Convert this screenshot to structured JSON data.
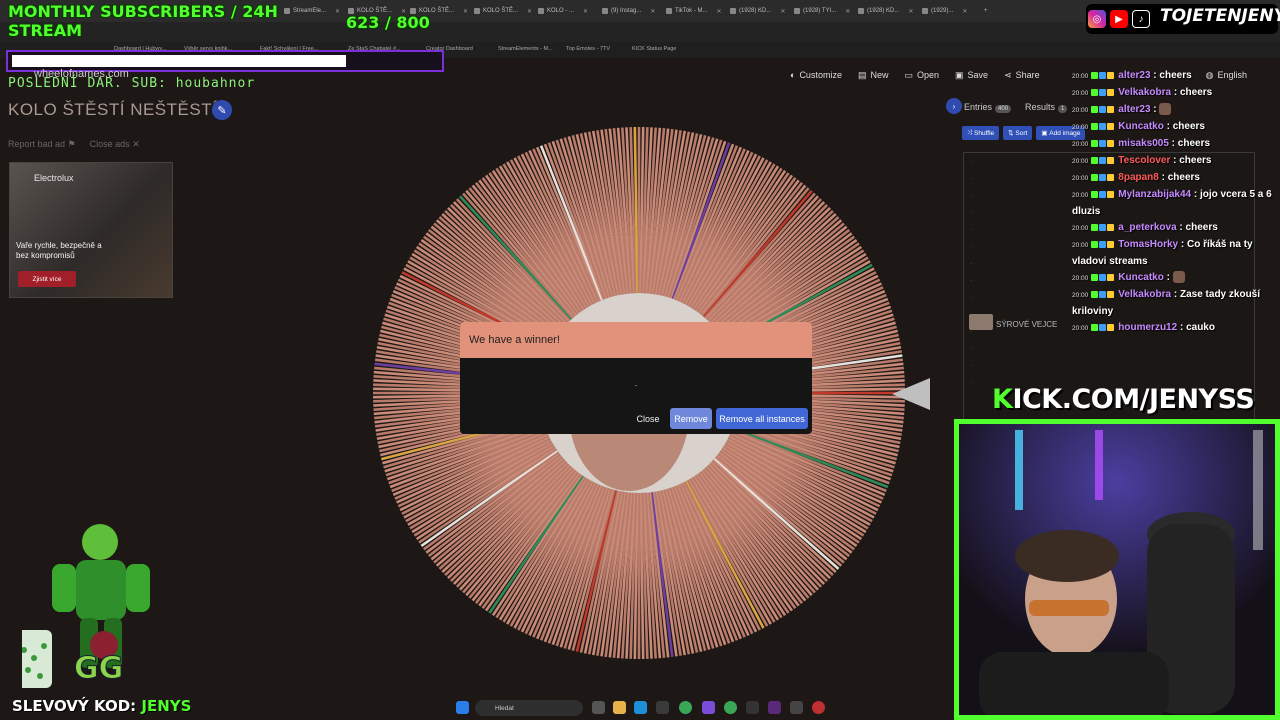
{
  "overlay": {
    "subs_title": "MONTHLY SUBSCRIBERS / 24H STREAM",
    "subs_count": "623 / 800",
    "last_donation": "POSLEDNÍ DAR. SUB: houbahnor",
    "social_handle": "TOJETENJENYS",
    "kick_url_k": "K",
    "kick_url_rest": "ICK.COM/JENYSS",
    "promo_label": "SLEVOVÝ KOD:",
    "promo_code": "JENYS",
    "accent_green": "#52ff2e"
  },
  "browser": {
    "tabs": [
      {
        "label": "StreamEle...",
        "icon": "streamelements-icon"
      },
      {
        "label": "KOLO ŠTĚ...",
        "icon": "wheel-icon"
      },
      {
        "label": "KOLO ŠTĚ...",
        "icon": "wheel-icon"
      },
      {
        "label": "KOLO ŠTĚ...",
        "icon": "wheel-icon"
      },
      {
        "label": "KOLO - ...",
        "icon": "wheel-icon"
      },
      {
        "label": "(9) Instag...",
        "icon": "instagram-icon"
      },
      {
        "label": "TikTok - M...",
        "icon": "tiktok-icon"
      },
      {
        "label": "(1928) KD...",
        "icon": "youtube-icon"
      },
      {
        "label": "(1928) TYI...",
        "icon": "youtube-icon"
      },
      {
        "label": "(1928) KD...",
        "icon": "youtube-icon"
      },
      {
        "label": "(1929)...",
        "icon": "youtube-icon"
      }
    ],
    "url": "wheelofnames.com",
    "bookmarks": [
      "Dashboard | Hubwy...",
      "Výběr servs knihk...",
      "Fakt! Schválení | Free...",
      "Ze StaS Chabatel #...",
      "Creator Dashboard",
      "StreamElements - M...",
      "Top Emotes - 7TV",
      "KICK Status Page"
    ]
  },
  "app": {
    "domain_text": "wheelofnames.com",
    "toolbar": [
      {
        "label": "Customize",
        "icon": "palette-icon"
      },
      {
        "label": "New",
        "icon": "file-icon"
      },
      {
        "label": "Open",
        "icon": "folder-icon"
      },
      {
        "label": "Save",
        "icon": "save-icon"
      },
      {
        "label": "Share",
        "icon": "share-icon"
      },
      {
        "label": "English",
        "icon": "globe-icon"
      }
    ],
    "wheel_title": "KOLO ŠTĚSTÍ NEŠTĚSTÍ",
    "report_ad": "Report bad ad",
    "close_ads": "Close ads",
    "ad": {
      "brand": "Electrolux",
      "text": "Vaře rychle, bezpečně a bez kompromisů",
      "cta": "Zjistit více"
    },
    "dialog": {
      "title": "We have a winner!",
      "winner": ".",
      "close": "Close",
      "remove": "Remove",
      "remove_all": "Remove all instances",
      "header_color": "#e2917b"
    },
    "entries": {
      "tab_entries": "Entries",
      "entries_count": "400",
      "tab_results": "Results",
      "results_count": "1",
      "shuffle": "Shuffle",
      "sort": "Sort",
      "add_image": "Add image",
      "visible_entry": "SÝROVÉ VEJCE"
    },
    "wheel_color": "#c98a78"
  },
  "chat": [
    {
      "time": "20:00",
      "user": "alter23",
      "color": "#c58aff",
      "text": "cheers"
    },
    {
      "time": "20:00",
      "user": "Velkakobra",
      "color": "#c58aff",
      "text": "cheers"
    },
    {
      "time": "20:00",
      "user": "alter23",
      "color": "#c58aff",
      "text": ""
    },
    {
      "time": "20:00",
      "user": "Kuncatko",
      "color": "#c58aff",
      "text": "cheers"
    },
    {
      "time": "20:00",
      "user": "misaks005",
      "color": "#c58aff",
      "text": "cheers"
    },
    {
      "time": "20:00",
      "user": "Tescolover",
      "color": "#ff5a5a",
      "text": "cheers"
    },
    {
      "time": "20:00",
      "user": "8papan8",
      "color": "#ff5a5a",
      "text": "cheers"
    },
    {
      "time": "20:00",
      "user": "Mylanzabijak44",
      "color": "#c58aff",
      "text": "jojo vcera 5 a 6 dluzis"
    },
    {
      "time": "20:00",
      "user": "a_peterkova",
      "color": "#c58aff",
      "text": "cheers"
    },
    {
      "time": "20:00",
      "user": "TomasHorky",
      "color": "#c58aff",
      "text": "Co říkáš na ty vladovi streams"
    },
    {
      "time": "20:00",
      "user": "Kuncatko",
      "color": "#c58aff",
      "text": ""
    },
    {
      "time": "20:00",
      "user": "Velkakobra",
      "color": "#c58aff",
      "text": "Zase tady zkouší kriloviny"
    },
    {
      "time": "20:00",
      "user": "houmerzu12",
      "color": "#c58aff",
      "text": "cauko"
    }
  ],
  "taskbar": {
    "search_placeholder": "Hledat"
  }
}
